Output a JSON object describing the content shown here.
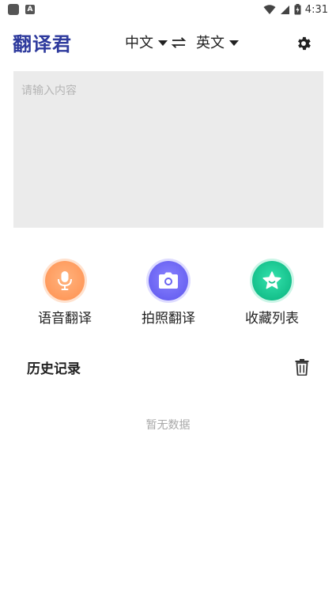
{
  "status_bar": {
    "time": "4:31"
  },
  "app_bar": {
    "logo": "翻译君",
    "source_language": "中文",
    "target_language": "英文"
  },
  "input": {
    "placeholder": "请输入内容",
    "value": ""
  },
  "actions": [
    {
      "label": "语音翻译",
      "icon": "microphone-icon",
      "color": "#ff9a5c"
    },
    {
      "label": "拍照翻译",
      "icon": "camera-icon",
      "color": "#6a63f2"
    },
    {
      "label": "收藏列表",
      "icon": "star-icon",
      "color": "#15c08b"
    }
  ],
  "history": {
    "title": "历史记录",
    "empty_text": "暂无数据"
  },
  "colors": {
    "logo": "#2e3a9d",
    "input_bg": "#ebebeb",
    "muted_text": "#a9a9a9"
  }
}
